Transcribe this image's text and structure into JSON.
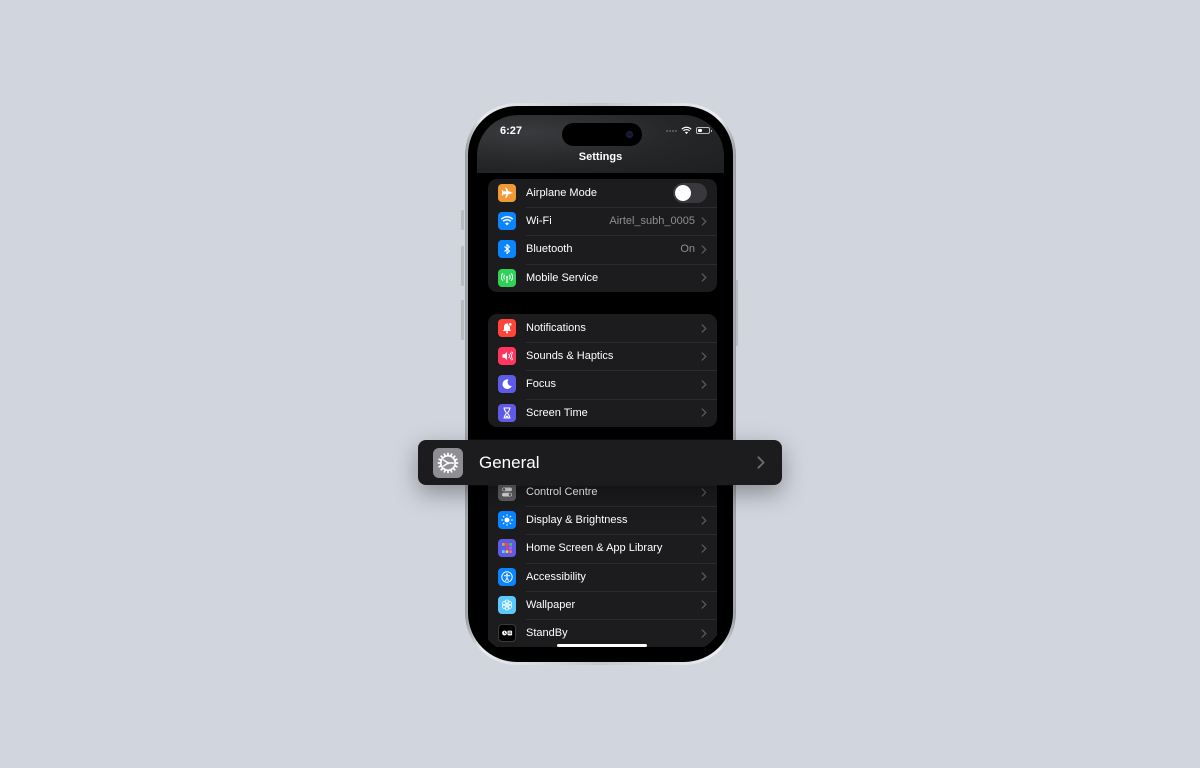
{
  "status_bar": {
    "time": "6:27"
  },
  "header": {
    "title": "Settings"
  },
  "groups": [
    {
      "items": [
        {
          "label": "Airplane Mode",
          "icon": "airplane-icon",
          "color": "#f09a37",
          "control": "toggle",
          "toggle_on": false
        },
        {
          "label": "Wi-Fi",
          "icon": "wifi-icon",
          "color": "#0a84ff",
          "value": "Airtel_subh_0005"
        },
        {
          "label": "Bluetooth",
          "icon": "bluetooth-icon",
          "color": "#0a84ff",
          "value": "On"
        },
        {
          "label": "Mobile Service",
          "icon": "antenna-icon",
          "color": "#30d158"
        }
      ]
    },
    {
      "items": [
        {
          "label": "Notifications",
          "icon": "bell-icon",
          "color": "#ff453a"
        },
        {
          "label": "Sounds & Haptics",
          "icon": "speaker-icon",
          "color": "#ff375f"
        },
        {
          "label": "Focus",
          "icon": "moon-icon",
          "color": "#5e5ce6"
        },
        {
          "label": "Screen Time",
          "icon": "hourglass-icon",
          "color": "#5e5ce6"
        }
      ]
    },
    {
      "items": [
        {
          "label": "Control Centre",
          "icon": "switches-icon",
          "color": "#636366"
        },
        {
          "label": "Display & Brightness",
          "icon": "sun-icon",
          "color": "#0a84ff"
        },
        {
          "label": "Home Screen & App Library",
          "icon": "grid-icon",
          "color": "#5e5ce6"
        },
        {
          "label": "Accessibility",
          "icon": "accessibility-icon",
          "color": "#0a84ff"
        },
        {
          "label": "Wallpaper",
          "icon": "flower-icon",
          "color": "#5ac8fa"
        },
        {
          "label": "StandBy",
          "icon": "standby-icon",
          "color": "#000000"
        }
      ]
    }
  ],
  "highlight": {
    "label": "General",
    "icon": "gear-icon",
    "color": "#8e8e93"
  }
}
